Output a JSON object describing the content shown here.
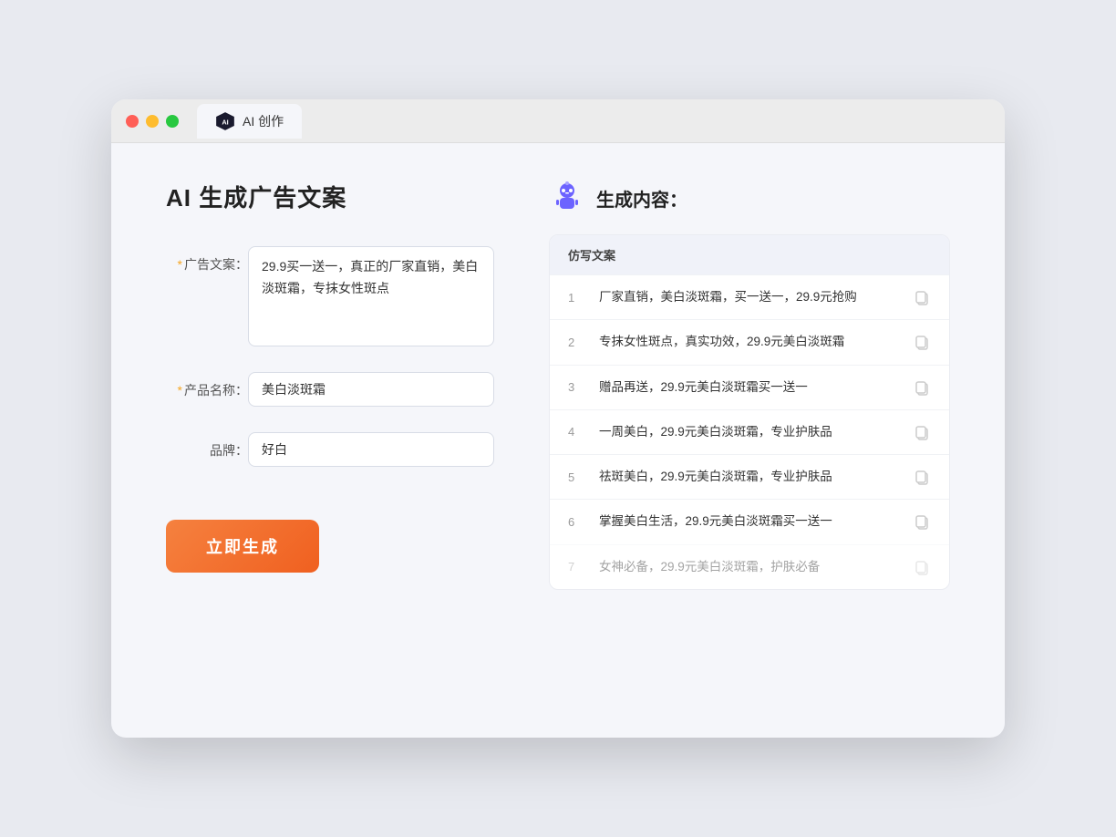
{
  "browser": {
    "tab_label": "AI 创作"
  },
  "page": {
    "title": "AI 生成广告文案"
  },
  "form": {
    "ad_copy_label": "广告文案：",
    "ad_copy_required": "*",
    "ad_copy_value": "29.9买一送一，真正的厂家直销，美白淡斑霜，专抹女性斑点",
    "product_name_label": "产品名称：",
    "product_name_required": "*",
    "product_name_value": "美白淡斑霜",
    "brand_label": "品牌：",
    "brand_value": "好白",
    "generate_btn_label": "立即生成"
  },
  "result": {
    "header_title": "生成内容：",
    "table_column": "仿写文案",
    "rows": [
      {
        "num": "1",
        "text": "厂家直销，美白淡斑霜，买一送一，29.9元抢购"
      },
      {
        "num": "2",
        "text": "专抹女性斑点，真实功效，29.9元美白淡斑霜"
      },
      {
        "num": "3",
        "text": "赠品再送，29.9元美白淡斑霜买一送一"
      },
      {
        "num": "4",
        "text": "一周美白，29.9元美白淡斑霜，专业护肤品"
      },
      {
        "num": "5",
        "text": "祛斑美白，29.9元美白淡斑霜，专业护肤品"
      },
      {
        "num": "6",
        "text": "掌握美白生活，29.9元美白淡斑霜买一送一"
      },
      {
        "num": "7",
        "text": "女神必备，29.9元美白淡斑霜，护肤必备"
      }
    ]
  }
}
